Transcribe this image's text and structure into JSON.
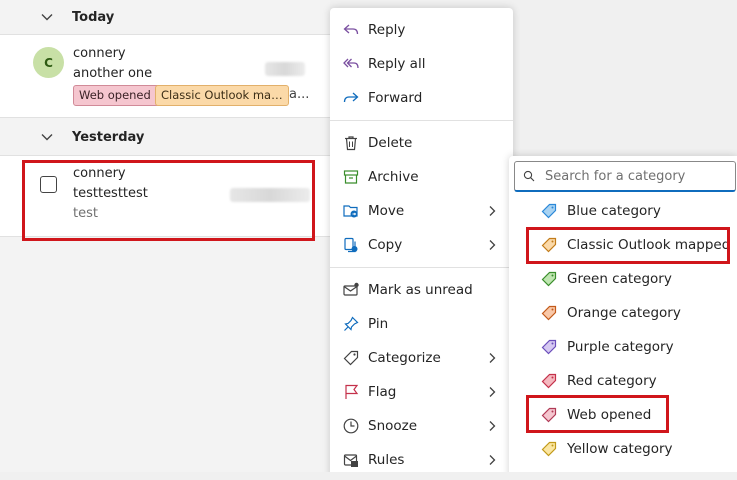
{
  "mail_list": {
    "groups": [
      {
        "title": "Today"
      },
      {
        "title": "Yesterday"
      }
    ],
    "messages": [
      {
        "avatar_initial": "C",
        "sender": "connery",
        "subject": "another one",
        "tags": [
          "Web opened",
          "Classic Outlook map..."
        ],
        "tags_more": "a...",
        "avatar_color": "#c8e0a6"
      },
      {
        "sender": "connery",
        "subject": "testtesttest",
        "preview": "test"
      }
    ]
  },
  "context_menu": {
    "items": [
      {
        "label": "Reply",
        "icon": "reply-icon"
      },
      {
        "label": "Reply all",
        "icon": "reply-all-icon"
      },
      {
        "label": "Forward",
        "icon": "forward-icon"
      },
      {
        "label": "Delete",
        "icon": "delete-icon"
      },
      {
        "label": "Archive",
        "icon": "archive-icon"
      },
      {
        "label": "Move",
        "icon": "move-icon",
        "submenu": true
      },
      {
        "label": "Copy",
        "icon": "copy-icon",
        "submenu": true
      },
      {
        "label": "Mark as unread",
        "icon": "mail-unread-icon"
      },
      {
        "label": "Pin",
        "icon": "pin-icon"
      },
      {
        "label": "Categorize",
        "icon": "tag-icon",
        "submenu": true
      },
      {
        "label": "Flag",
        "icon": "flag-icon",
        "submenu": true
      },
      {
        "label": "Snooze",
        "icon": "clock-icon",
        "submenu": true
      },
      {
        "label": "Rules",
        "icon": "rules-icon",
        "submenu": true
      }
    ]
  },
  "category_menu": {
    "search_placeholder": "Search for a category",
    "categories": [
      {
        "label": "Blue category",
        "color": "#a9d3f2",
        "stroke": "#2b88d8"
      },
      {
        "label": "Classic Outlook mapped",
        "color": "#fbd9a8",
        "stroke": "#c27c1a"
      },
      {
        "label": "Green category",
        "color": "#bfe6b1",
        "stroke": "#3a8e2c"
      },
      {
        "label": "Orange category",
        "color": "#f9c8a8",
        "stroke": "#c25a1a"
      },
      {
        "label": "Purple category",
        "color": "#d6c9f2",
        "stroke": "#6b4fbb"
      },
      {
        "label": "Red category",
        "color": "#f5b9c0",
        "stroke": "#c4314b"
      },
      {
        "label": "Web opened",
        "color": "#f5c6cf",
        "stroke": "#b03a56"
      },
      {
        "label": "Yellow category",
        "color": "#fbe6a2",
        "stroke": "#c29a1a"
      }
    ]
  },
  "colors": {
    "highlight": "#d0161b",
    "accent": "#0f6cbd",
    "icon_purple": "#7a4fa0"
  }
}
